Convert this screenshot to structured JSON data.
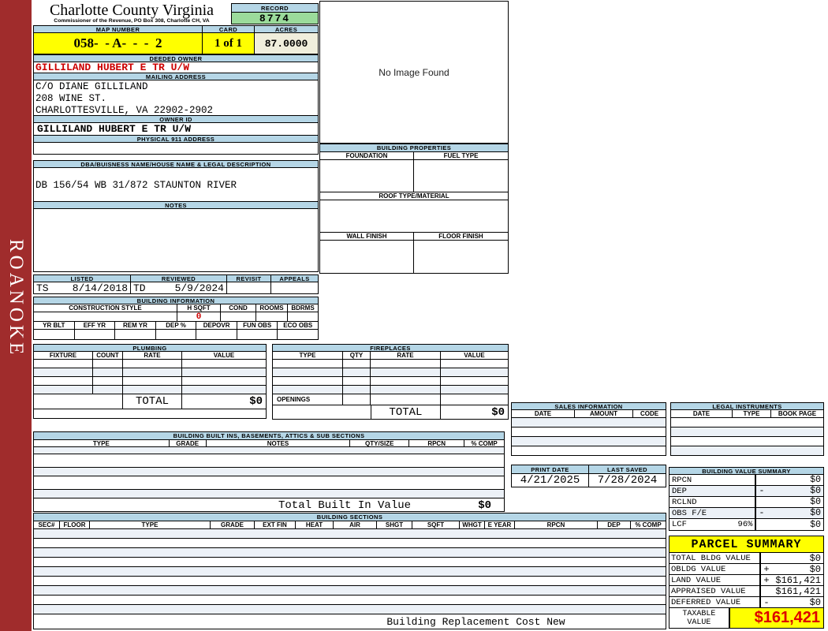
{
  "colors": {
    "sidebar_red": "#A02C2C",
    "band_blue": "#B5D6E6",
    "record_green": "#9BDB9B",
    "highlight_yellow": "#FFFF00",
    "acres_cream": "#F0EEDC",
    "owner_red": "#CC0000",
    "taxable_red": "#DD0000",
    "row_tint": "#ECF1F7"
  },
  "sidebar": {
    "region_label": "ROANOKE"
  },
  "header": {
    "county_title": "Charlotte County Virginia",
    "commissioner_line": "Commissioner of the Revenue, PO Box 308, Charlotte CH, VA",
    "record_label": "RECORD",
    "record_number": "8774",
    "map_number_label": "MAP NUMBER",
    "map_number": "058-  - A-  -  -  2",
    "card_label": "CARD",
    "card": "1 of 1",
    "acres_label": "ACRES",
    "acres": "87.0000"
  },
  "owner": {
    "deeded_owner_label": "DEEDED OWNER",
    "deeded_owner": "GILLILAND HUBERT E TR U/W",
    "mailing_address_label": "MAILING ADDRESS",
    "mailing_line1": "C/O DIANE GILLILAND",
    "mailing_line2": "208 WINE ST.",
    "mailing_line3": "CHARLOTTESVILLE, VA 22902-2902",
    "owner_id_label": "OWNER ID",
    "owner_id": "GILLILAND HUBERT E TR U/W",
    "physical_911_label": "PHYSICAL 911 ADDRESS"
  },
  "legal_desc": {
    "dba_label": "DBA/BUISNESS NAME/HOUSE NAME & LEGAL DESCRIPTION",
    "description": "DB 156/54 WB 31/872 STAUNTON RIVER",
    "notes_label": "NOTES"
  },
  "review": {
    "listed_label": "LISTED",
    "reviewed_label": "REVIEWED",
    "revisit_label": "REVISIT",
    "appeals_label": "APPEALS",
    "listed_by": "TS",
    "listed_date": "8/14/2018",
    "reviewed_by": "TD",
    "reviewed_date": "5/9/2024"
  },
  "building_info": {
    "title": "BUILDING INFORMATION",
    "construction_style_label": "CONSTRUCTION STYLE",
    "h_sqft_label": "H SQFT",
    "h_sqft": "0",
    "cond_label": "COND",
    "rooms_label": "ROOMS",
    "bdrms_label": "BDRMS",
    "yr_blt_label": "YR BLT",
    "eff_yr_label": "EFF YR",
    "rem_yr_label": "REM YR",
    "dep_pct_label": "DEP %",
    "depovr_label": "DEPOVR",
    "fun_obs_label": "FUN OBS",
    "eco_obs_label": "ECO OBS"
  },
  "plumbing": {
    "title": "PLUMBING",
    "headers": [
      "FIXTURE",
      "COUNT",
      "RATE",
      "VALUE"
    ],
    "total_label": "TOTAL",
    "total_value": "$0"
  },
  "fireplaces": {
    "title": "FIREPLACES",
    "headers": [
      "TYPE",
      "QTY",
      "RATE",
      "VALUE"
    ],
    "openings_label": "OPENINGS",
    "total_label": "TOTAL",
    "total_value": "$0"
  },
  "built_ins": {
    "title": "BUILDING BUILT INS, BASEMENTS, ATTICS & SUB SECTIONS",
    "headers": [
      "TYPE",
      "GRADE",
      "NOTES",
      "QTY/SIZE",
      "RPCN",
      "% COMP"
    ],
    "total_label": "Total Built In Value",
    "total_value": "$0"
  },
  "building_sections": {
    "title": "BUILDING SECTIONS",
    "headers": [
      "SEC#",
      "FLOOR",
      "TYPE",
      "GRADE",
      "EXT FIN",
      "HEAT",
      "AIR",
      "SHGT",
      "SQFT",
      "WHGT",
      "E YEAR",
      "RPCN",
      "DEP",
      "% COMP"
    ],
    "footer_label": "Building Replacement Cost New"
  },
  "image_panel": {
    "message": "No Image Found"
  },
  "building_properties": {
    "title": "BUILDING PROPERTIES",
    "foundation_label": "FOUNDATION",
    "fuel_type_label": "FUEL TYPE",
    "roof_label": "ROOF TYPE/MATERIAL",
    "wall_finish_label": "WALL FINISH",
    "floor_finish_label": "FLOOR FINISH"
  },
  "sales": {
    "title": "SALES INFORMATION",
    "headers": [
      "DATE",
      "AMOUNT",
      "CODE"
    ]
  },
  "legal_instruments": {
    "title": "LEGAL INSTRUMENTS",
    "headers": [
      "DATE",
      "TYPE",
      "BOOK PAGE"
    ]
  },
  "dates": {
    "print_date_label": "PRINT DATE",
    "print_date": "4/21/2025",
    "last_saved_label": "LAST SAVED",
    "last_saved": "7/28/2024"
  },
  "building_value_summary": {
    "title": "BUILDING VALUE SUMMARY",
    "rows": [
      {
        "label": "RPCN",
        "extra": "",
        "op": "",
        "value": "$0"
      },
      {
        "label": "DEP",
        "extra": "",
        "op": "-",
        "value": "$0"
      },
      {
        "label": "RCLND",
        "extra": "",
        "op": "",
        "value": "$0"
      },
      {
        "label": "OBS F/E",
        "extra": "",
        "op": "-",
        "value": "$0"
      },
      {
        "label": "LCF",
        "extra": "96%",
        "op": "",
        "value": "$0"
      }
    ]
  },
  "parcel_summary": {
    "title": "PARCEL SUMMARY",
    "rows": [
      {
        "label": "TOTAL BLDG VALUE",
        "op": "",
        "value": "$0"
      },
      {
        "label": "OBLDG VALUE",
        "op": "+",
        "value": "$0"
      },
      {
        "label": "LAND VALUE",
        "op": "+",
        "value": "$161,421"
      },
      {
        "label": "APPRAISED VALUE",
        "op": "",
        "value": "$161,421"
      },
      {
        "label": "DEFERRED VALUE",
        "op": "-",
        "value": "$0"
      }
    ],
    "taxable_label": "TAXABLE VALUE",
    "taxable_value": "$161,421"
  }
}
